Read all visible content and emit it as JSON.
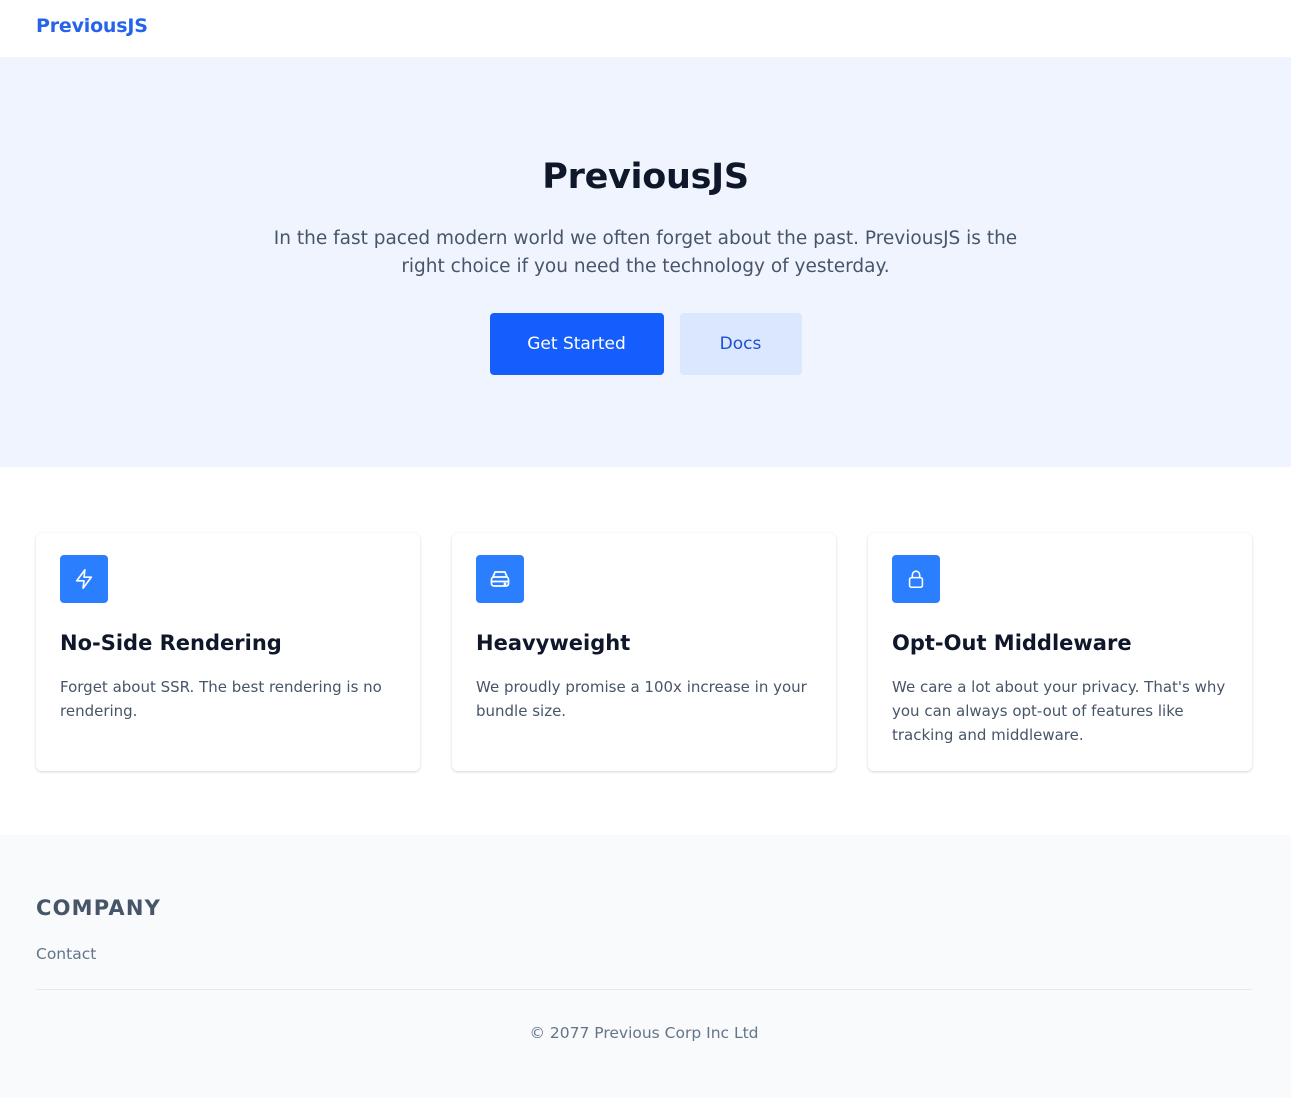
{
  "header": {
    "brand": "PreviousJS"
  },
  "hero": {
    "title": "PreviousJS",
    "description": "In the fast paced modern world we often forget about the past. PreviousJS is the right choice if you need the technology of yesterday.",
    "primary_button": "Get Started",
    "secondary_button": "Docs"
  },
  "features": [
    {
      "icon": "lightning-icon",
      "title": "No-Side Rendering",
      "text": "Forget about SSR. The best rendering is no rendering."
    },
    {
      "icon": "server-icon",
      "title": "Heavyweight",
      "text": "We proudly promise a 100x increase in your bundle size."
    },
    {
      "icon": "lock-icon",
      "title": "Opt-Out Middleware",
      "text": "We care a lot about your privacy. That's why you can always opt-out of features like tracking and middleware."
    }
  ],
  "footer": {
    "heading": "COMPANY",
    "links": [
      "Contact"
    ],
    "copyright": "© 2077 Previous Corp Inc Ltd"
  },
  "colors": {
    "brand": "#2563eb",
    "primary_button": "#155dfc",
    "hero_background": "#eff4ff",
    "icon_background": "#2b7fff"
  }
}
